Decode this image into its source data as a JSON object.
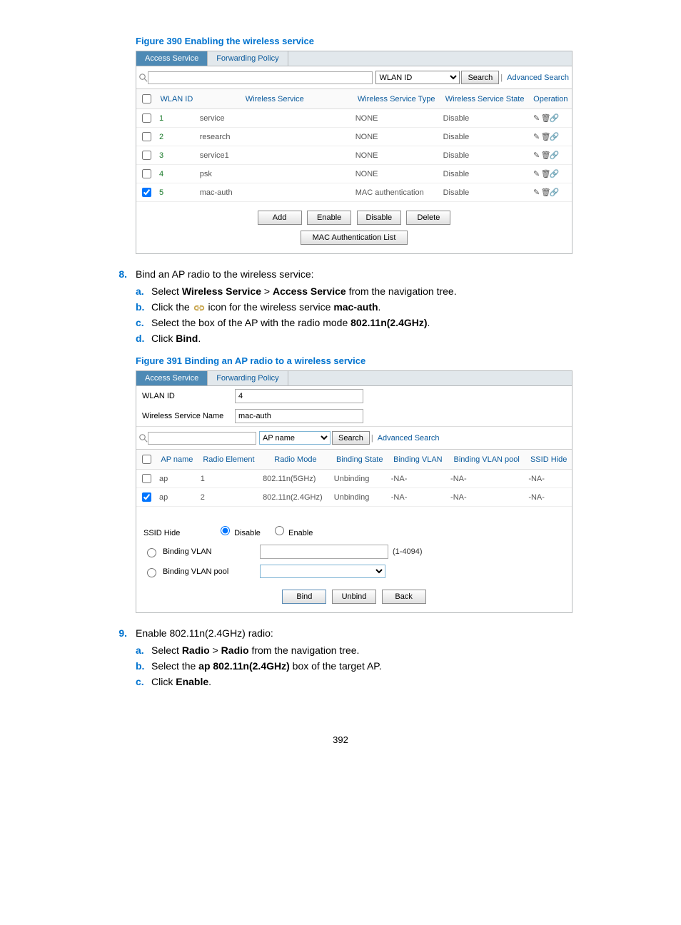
{
  "figure390": {
    "title": "Figure 390 Enabling the wireless service",
    "tabs": [
      "Access Service",
      "Forwarding Policy"
    ],
    "searchField": "WLAN ID",
    "searchBtn": "Search",
    "advancedSearch": "Advanced Search",
    "headers": [
      "WLAN ID",
      "Wireless Service",
      "Wireless Service Type",
      "Wireless Service State",
      "Operation"
    ],
    "rows": [
      {
        "checked": false,
        "id": "1",
        "svc": "service",
        "type": "NONE",
        "state": "Disable"
      },
      {
        "checked": false,
        "id": "2",
        "svc": "research",
        "type": "NONE",
        "state": "Disable"
      },
      {
        "checked": false,
        "id": "3",
        "svc": "service1",
        "type": "NONE",
        "state": "Disable"
      },
      {
        "checked": false,
        "id": "4",
        "svc": "psk",
        "type": "NONE",
        "state": "Disable"
      },
      {
        "checked": true,
        "id": "5",
        "svc": "mac-auth",
        "type": "MAC authentication",
        "state": "Disable"
      }
    ],
    "buttons": [
      "Add",
      "Enable",
      "Disable",
      "Delete"
    ],
    "macBtn": "MAC Authentication List"
  },
  "step8": {
    "num": "8.",
    "title": "Bind an AP radio to the wireless service:",
    "a": [
      "Select ",
      "Wireless Service",
      " > ",
      "Access Service",
      " from the navigation tree."
    ],
    "b_pre": "Click the ",
    "b_post": " icon for the wireless service ",
    "b_bold": "mac-auth",
    "b_end": ".",
    "c": [
      "Select the box of the AP with the radio mode ",
      "802.11n(2.4GHz)",
      "."
    ],
    "d": [
      "Click ",
      "Bind",
      "."
    ]
  },
  "figure391": {
    "title": "Figure 391 Binding an AP radio to a wireless service",
    "tabs": [
      "Access Service",
      "Forwarding Policy"
    ],
    "wlanIdLabel": "WLAN ID",
    "wlanIdVal": "4",
    "wsNameLabel": "Wireless Service Name",
    "wsNameVal": "mac-auth",
    "searchField": "AP name",
    "searchBtn": "Search",
    "advancedSearch": "Advanced Search",
    "headers": [
      "AP name",
      "Radio Element",
      "Radio Mode",
      "Binding State",
      "Binding VLAN",
      "Binding VLAN pool",
      "SSID Hide"
    ],
    "rows": [
      {
        "checked": false,
        "ap": "ap",
        "re": "1",
        "mode": "802.11n(5GHz)",
        "bs": "Unbinding",
        "bv": "-NA-",
        "bp": "-NA-",
        "sh": "-NA-"
      },
      {
        "checked": true,
        "ap": "ap",
        "re": "2",
        "mode": "802.11n(2.4GHz)",
        "bs": "Unbinding",
        "bv": "-NA-",
        "bp": "-NA-",
        "sh": "-NA-"
      }
    ],
    "ssidHideLabel": "SSID Hide",
    "ssidOptions": [
      "Disable",
      "Enable"
    ],
    "bvLabel": "Binding VLAN",
    "bvHint": "(1-4094)",
    "bpLabel": "Binding VLAN pool",
    "buttons": [
      "Bind",
      "Unbind",
      "Back"
    ]
  },
  "step9": {
    "num": "9.",
    "title": "Enable 802.11n(2.4GHz) radio:",
    "a": [
      "Select ",
      "Radio",
      " > ",
      "Radio",
      " from the navigation tree."
    ],
    "b": [
      "Select the ",
      "ap 802.11n(2.4GHz)",
      " box of the target AP."
    ],
    "c": [
      "Click ",
      "Enable",
      "."
    ]
  },
  "pageNumber": "392"
}
